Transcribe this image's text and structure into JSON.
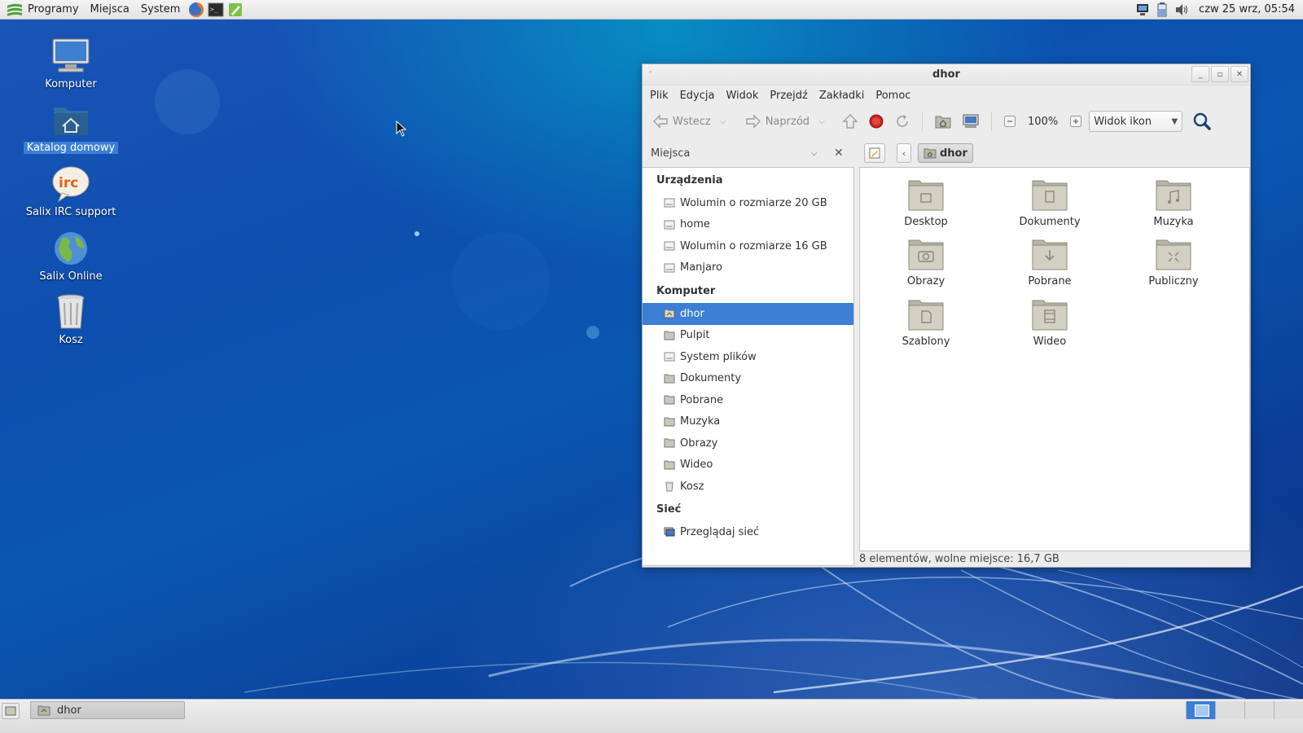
{
  "top_panel": {
    "menus": [
      "Programy",
      "Miejsca",
      "System"
    ],
    "launchers": [
      "firefox-icon",
      "terminal-icon",
      "text-editor-icon"
    ],
    "tray_icons": [
      "network-icon",
      "battery-icon",
      "volume-icon"
    ],
    "clock": "czw 25 wrz, 05:54"
  },
  "desktop": {
    "icons": [
      {
        "label": "Komputer",
        "icon": "computer-icon"
      },
      {
        "label": "Katalog domowy",
        "icon": "home-folder-icon",
        "selected": true
      },
      {
        "label": "Salix IRC support",
        "icon": "irc-icon"
      },
      {
        "label": "Salix Online",
        "icon": "globe-icon"
      },
      {
        "label": "Kosz",
        "icon": "trash-icon"
      }
    ]
  },
  "window": {
    "title": "dhor",
    "menubar": [
      "Plik",
      "Edycja",
      "Widok",
      "Przejdź",
      "Zakładki",
      "Pomoc"
    ],
    "toolbar": {
      "back_label": "Wstecz",
      "forward_label": "Naprzód",
      "zoom": "100%",
      "view_mode": "Widok ikon"
    },
    "places_label": "Miejsca",
    "breadcrumb": "dhor",
    "sidebar": {
      "devices_header": "Urządzenia",
      "devices": [
        "Wolumin o rozmiarze 20 GB",
        "home",
        "Wolumin o rozmiarze 16 GB",
        "Manjaro"
      ],
      "computer_header": "Komputer",
      "computer": [
        "dhor",
        "Pulpit",
        "System plików",
        "Dokumenty",
        "Pobrane",
        "Muzyka",
        "Obrazy",
        "Wideo",
        "Kosz"
      ],
      "network_header": "Sieć",
      "network": [
        "Przeglądaj sieć"
      ]
    },
    "files": [
      {
        "label": "Desktop",
        "icon": "desktop-folder-icon"
      },
      {
        "label": "Dokumenty",
        "icon": "documents-folder-icon"
      },
      {
        "label": "Muzyka",
        "icon": "music-folder-icon"
      },
      {
        "label": "Obrazy",
        "icon": "pictures-folder-icon"
      },
      {
        "label": "Pobrane",
        "icon": "downloads-folder-icon"
      },
      {
        "label": "Publiczny",
        "icon": "public-folder-icon"
      },
      {
        "label": "Szablony",
        "icon": "templates-folder-icon"
      },
      {
        "label": "Wideo",
        "icon": "videos-folder-icon"
      }
    ],
    "status": "8 elementów, wolne miejsce: 16,7 GB"
  },
  "bottom_panel": {
    "task": "dhor",
    "workspaces": 4,
    "active_workspace": 1
  },
  "colors": {
    "selection": "#3d7fd6",
    "panel": "#e6e6e6",
    "folder": "#c8c6b8"
  }
}
